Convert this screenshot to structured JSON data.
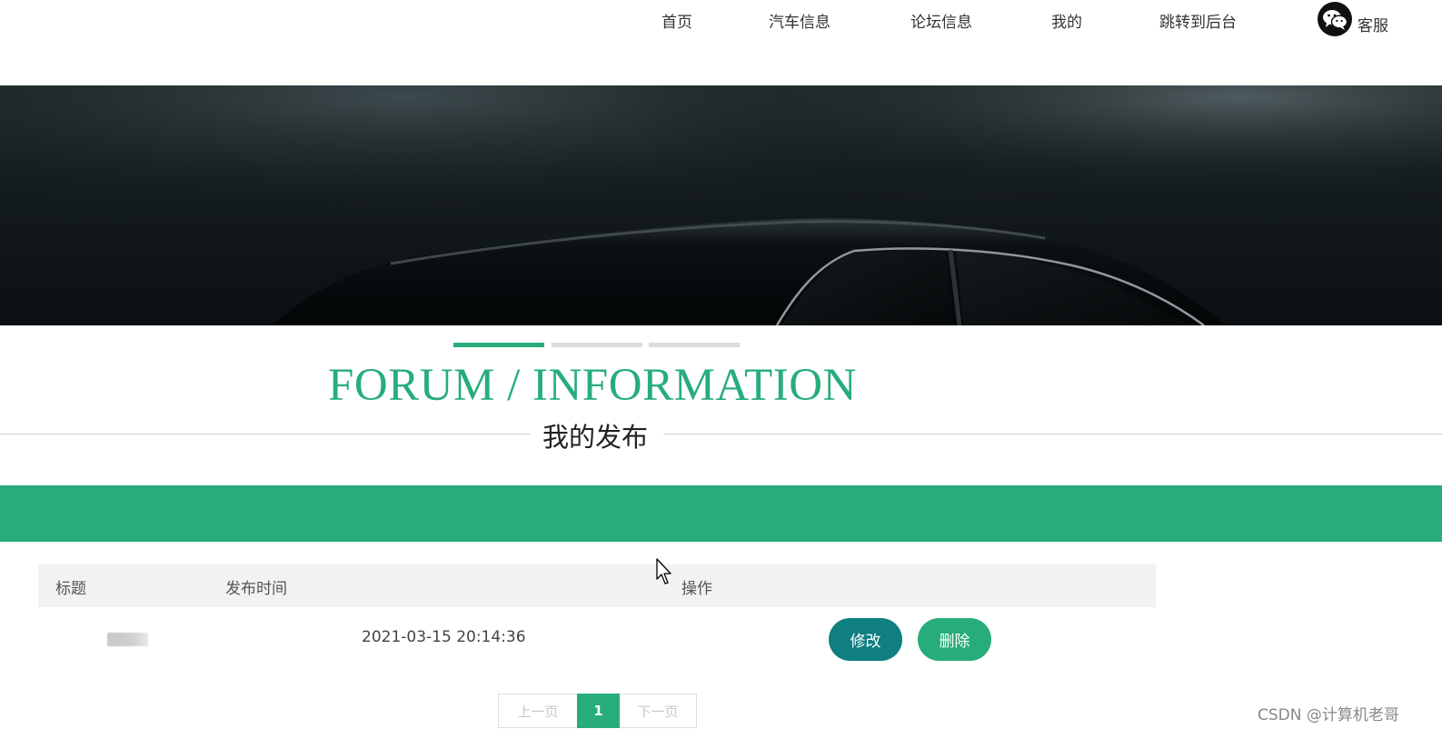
{
  "nav": {
    "items": [
      {
        "label": "首页"
      },
      {
        "label": "汽车信息"
      },
      {
        "label": "论坛信息"
      },
      {
        "label": "我的"
      },
      {
        "label": "跳转到后台"
      }
    ],
    "service_label": "客服",
    "service_icon": "wechat-icon"
  },
  "banner": {
    "indicators": {
      "count": 3,
      "active": 0,
      "active_color": "#26ad7a"
    }
  },
  "section": {
    "title_en": "FORUM / INFORMATION",
    "title_cn": "我的发布",
    "accent_color": "#26ad7a"
  },
  "table": {
    "headers": {
      "title": "标题",
      "time": "发布时间",
      "action": "操作"
    },
    "rows": [
      {
        "time": "2021-03-15 20:14:36",
        "edit_label": "修改",
        "delete_label": "删除"
      }
    ]
  },
  "pagination": {
    "prev_label": "上一页",
    "current": "1",
    "next_label": "下一页"
  },
  "watermark": "CSDN @计算机老哥"
}
